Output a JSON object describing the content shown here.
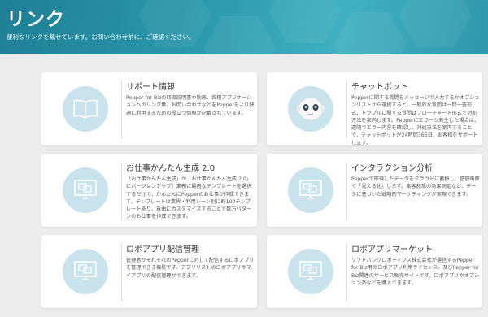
{
  "header": {
    "title": "リンク",
    "subtitle": "便利なリンクを載せています。お問い合わせ前に、ご確認ください。"
  },
  "cards": [
    {
      "title": "サポート情報",
      "description": "Pepper for Bizの取扱説明書や動画、各種アプリケーションへのリンク集。お問い合わせなどをPepperをより快適に利用するための役立つ情報が記載されています。",
      "icon": "book-icon"
    },
    {
      "title": "チャットボット",
      "description": "Pepperに関する質問をメッセージで入力するかオプションリストから選択すると、一般的な質問は一問一答形式、トラブルに関する質問はフローチャート形式で対処方法を案内します。Pepperにエラーが発生した場合は、遠隔でエラー内容を確認し、対処方法を案内することで、チャットボットが24時間365日、お客様をサポートします。",
      "icon": "pepper-robot-icon"
    },
    {
      "title": "お仕事かんたん生成 2.0",
      "description": "「お仕事かんたん生成」が「お仕事かんたん生成 2.0」にバージョンアップ！業務に最適なテンプレートを選択するだけで、かんたんにPepperのお仕事が作成できます。テンプレートは業界・利用シーン別に約100テンプレートあり、自由にカスタマイズすることで数万パターンのお仕事を作成できます。",
      "icon": "monitor-icon"
    },
    {
      "title": "インタラクション分析",
      "description": "Pepperで取得したデータをクラウドに蓄積し、管理画面で「見える化」します。集客施策の効果測定など、データに基づいた戦略的マーケティングが実現できます。",
      "icon": "monitor-icon"
    },
    {
      "title": "ロボアプリ配信管理",
      "description": "管理者がそれぞれのPepperに対して配信するロボアプリを管理できる機能です。アプリリストのロボアプリやマイアプリの配信管理ができます。",
      "icon": "monitor-icon"
    },
    {
      "title": "ロボアプリマーケット",
      "description": "ソフトバンクロボティクス株式会社が運営するPepper for Biz用のロボアプリ利用ライセンス、及びPepper for Biz関連のサービス販売サイトです。ロボアプリやオプション品などを購入できます。",
      "icon": "monitor-icon"
    }
  ]
}
